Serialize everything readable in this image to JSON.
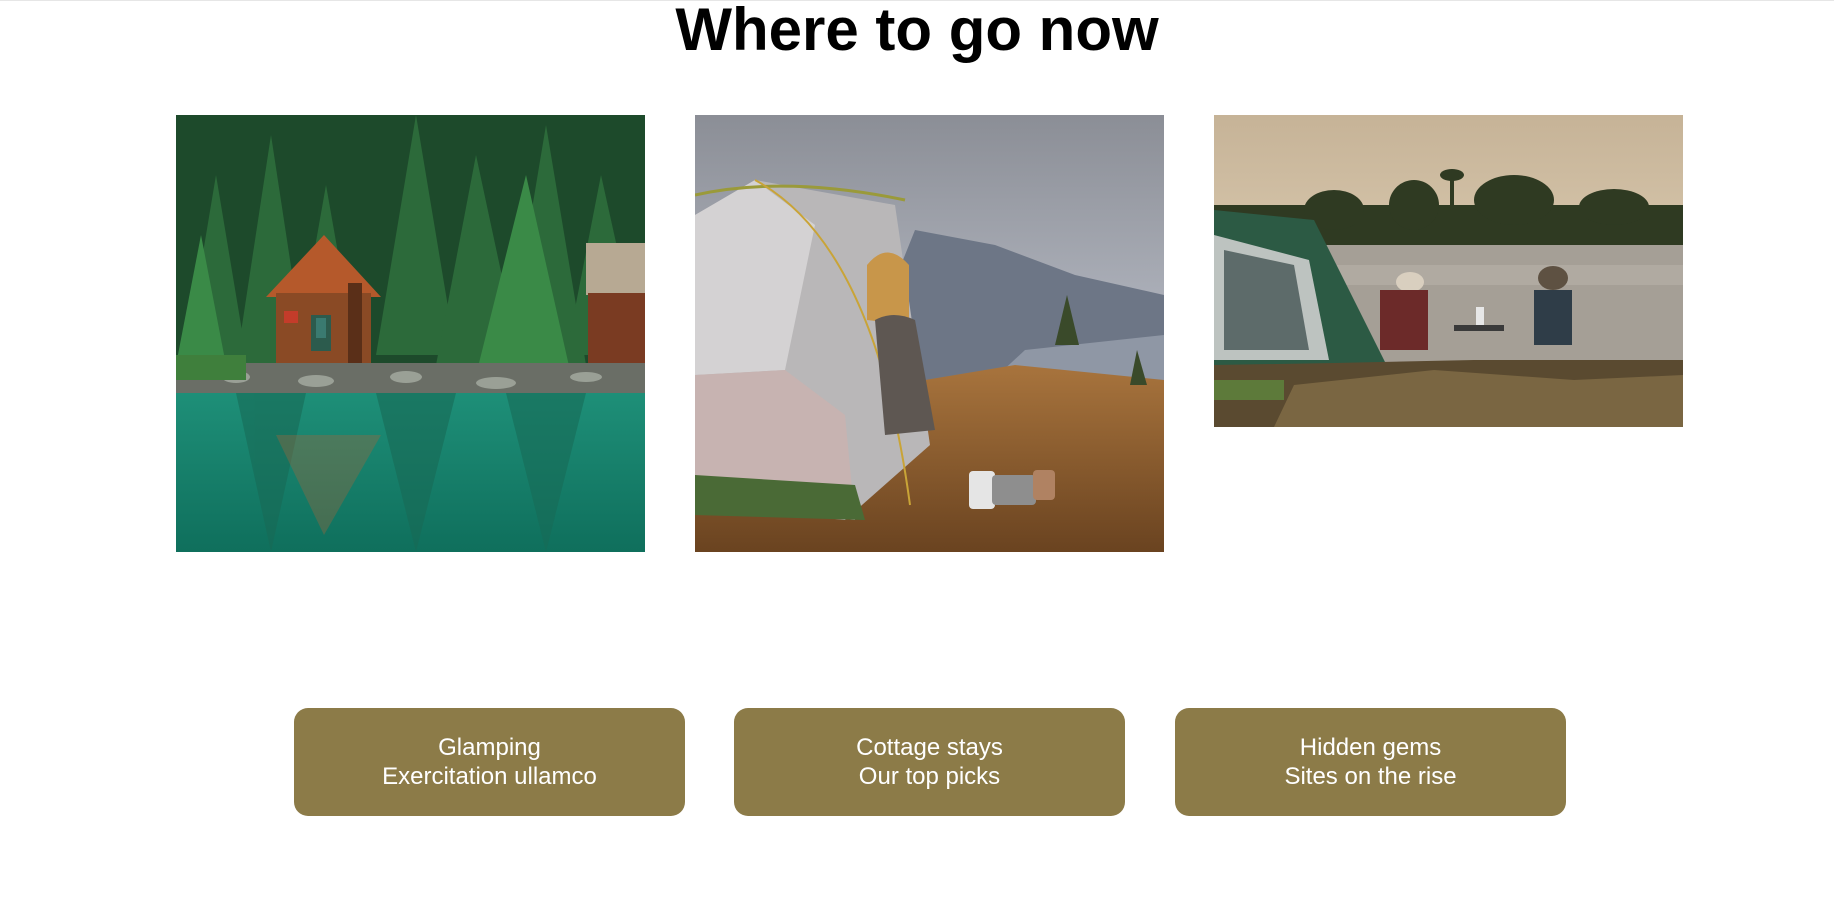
{
  "page": {
    "title": "Where to go now"
  },
  "theme": {
    "button_color": "#8C7B48",
    "button_text_color": "#FFFFFF",
    "title_color": "#000000"
  },
  "cards": [
    {
      "id": "cabin",
      "image_subject": "log cabin by a forest lake"
    },
    {
      "id": "tent",
      "image_subject": "woman in tent on mountain hillside at sunset"
    },
    {
      "id": "lakeside",
      "image_subject": "couple camping by a lake with tent and folding chairs"
    }
  ],
  "buttons": [
    {
      "line1": "Glamping",
      "line2": "Exercitation ullamco"
    },
    {
      "line1": "Cottage stays",
      "line2": "Our top picks"
    },
    {
      "line1": "Hidden gems",
      "line2": "Sites on the rise"
    }
  ]
}
